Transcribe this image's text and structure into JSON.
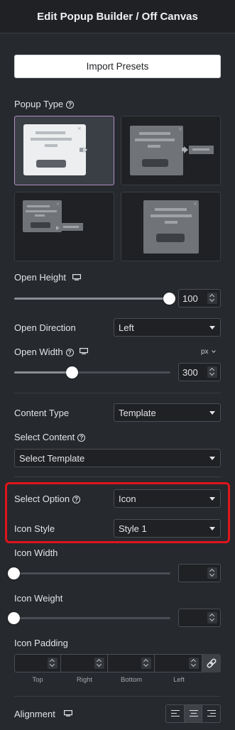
{
  "header": {
    "title": "Edit Popup Builder / Off Canvas"
  },
  "import_button": "Import Presets",
  "popup_type": {
    "label": "Popup Type",
    "help_icon": "help-icon"
  },
  "open_height": {
    "label": "Open Height",
    "value": "100",
    "slider_fraction": 1.0,
    "device_icon": "desktop-icon"
  },
  "open_direction": {
    "label": "Open Direction",
    "value": "Left"
  },
  "open_width": {
    "label": "Open Width",
    "unit": "px",
    "value": "300",
    "slider_fraction": 0.38
  },
  "content_type": {
    "label": "Content Type",
    "value": "Template"
  },
  "select_content": {
    "label": "Select Content",
    "value": "Select Template"
  },
  "select_option": {
    "label": "Select Option",
    "value": "Icon"
  },
  "icon_style": {
    "label": "Icon Style",
    "value": "Style 1"
  },
  "icon_width": {
    "label": "Icon Width",
    "value": "",
    "slider_fraction": 0.0
  },
  "icon_weight": {
    "label": "Icon Weight",
    "value": "",
    "slider_fraction": 0.0
  },
  "icon_padding": {
    "label": "Icon Padding",
    "sides": [
      "Top",
      "Right",
      "Bottom",
      "Left"
    ],
    "link_icon": "link-icon"
  },
  "alignment": {
    "label": "Alignment",
    "options": [
      "align-left-icon",
      "align-center-icon",
      "align-right-icon"
    ],
    "selected": "center"
  },
  "colors": {
    "accent_highlight": "#e0141c",
    "active_card_border": "#b48ec9"
  }
}
